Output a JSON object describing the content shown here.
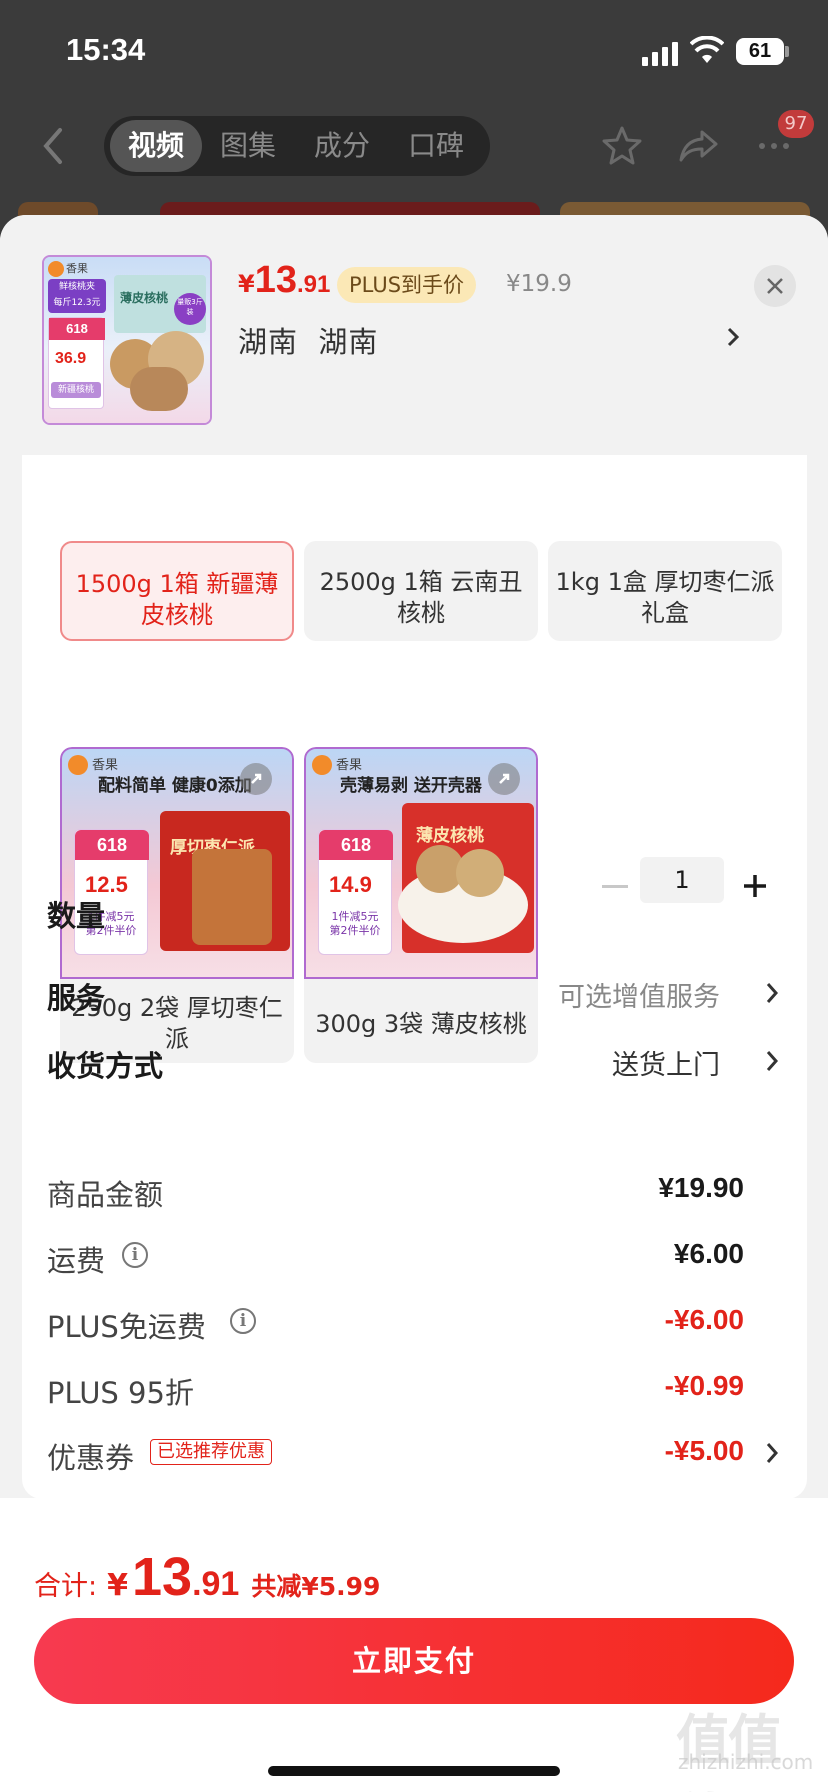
{
  "status_bar": {
    "time": "15:34",
    "battery": "61"
  },
  "nav": {
    "tabs": [
      "视频",
      "图集",
      "成分",
      "口碑"
    ],
    "active_tab": 0,
    "badge": "97"
  },
  "header": {
    "price_symbol": "¥",
    "price_integer": "13",
    "price_decimal": ".91",
    "plus_tag": "PLUS到手价",
    "original_price": "¥19.9",
    "location": "湖南  湖南",
    "thumb_text": {
      "brand": "香果",
      "promo": "鲜核桃夹",
      "per_jin": "每斤12.3元",
      "badge618": "618",
      "price": "36.9",
      "product": "薄皮核桃",
      "weight": "量贩3斤装",
      "footer": "新疆核桃"
    }
  },
  "variants": [
    {
      "label": "1500g 1箱 新疆薄皮核桃",
      "selected": true
    },
    {
      "label": "2500g 1箱 云南丑核桃",
      "selected": false
    },
    {
      "label": "1kg 1盒 厚切枣仁派礼盒",
      "selected": false
    },
    {
      "label": "250g 2袋 厚切枣仁派",
      "selected": false,
      "img": {
        "brand": "香果",
        "slogan": "配料简单 健康0添加",
        "badge618": "618",
        "price": "12.5",
        "promo1": "1件减5元",
        "promo2": "第2件半价",
        "product": "厚切枣仁派"
      }
    },
    {
      "label": "300g 3袋 薄皮核桃",
      "selected": false,
      "img": {
        "brand": "香果",
        "slogan": "壳薄易剥 送开壳器",
        "badge618": "618",
        "price": "14.9",
        "promo1": "1件减5元",
        "promo2": "第2件半价",
        "product": "薄皮核桃"
      }
    }
  ],
  "quantity": {
    "label": "数量",
    "value": "1"
  },
  "service": {
    "label": "服务",
    "value": "可选增值服务"
  },
  "delivery": {
    "label": "收货方式",
    "value": "送货上门"
  },
  "fees": [
    {
      "label": "商品金额",
      "value": "¥19.90",
      "red": false,
      "info": false
    },
    {
      "label": "运费",
      "value": "¥6.00",
      "red": false,
      "info": true
    },
    {
      "label": "PLUS免运费",
      "value": "-¥6.00",
      "red": true,
      "info": true
    },
    {
      "label": "PLUS 95折",
      "value": "-¥0.99",
      "red": true,
      "info": false
    },
    {
      "label": "优惠券",
      "value": "-¥5.00",
      "red": true,
      "info": false,
      "tag": "已选推荐优惠"
    }
  ],
  "footer": {
    "total_label": "合计:",
    "total_symbol": "¥",
    "total_integer": "13",
    "total_decimal": ".91",
    "total_saved": "共减¥5.99",
    "pay_button": "立即支付",
    "watermark": "值值值",
    "watermark_sub": "zhizhizhi.com"
  },
  "colors": {
    "accent": "#e2231a",
    "plus_tag_bg": "#fbe8b6",
    "pay_gradient_start": "#f73a50",
    "pay_gradient_end": "#f5291c"
  },
  "icons": [
    "back-arrow-icon",
    "star-icon",
    "share-icon",
    "more-icon",
    "close-icon",
    "chevron-right-icon",
    "minus-icon",
    "plus-icon",
    "info-icon",
    "expand-icon"
  ]
}
